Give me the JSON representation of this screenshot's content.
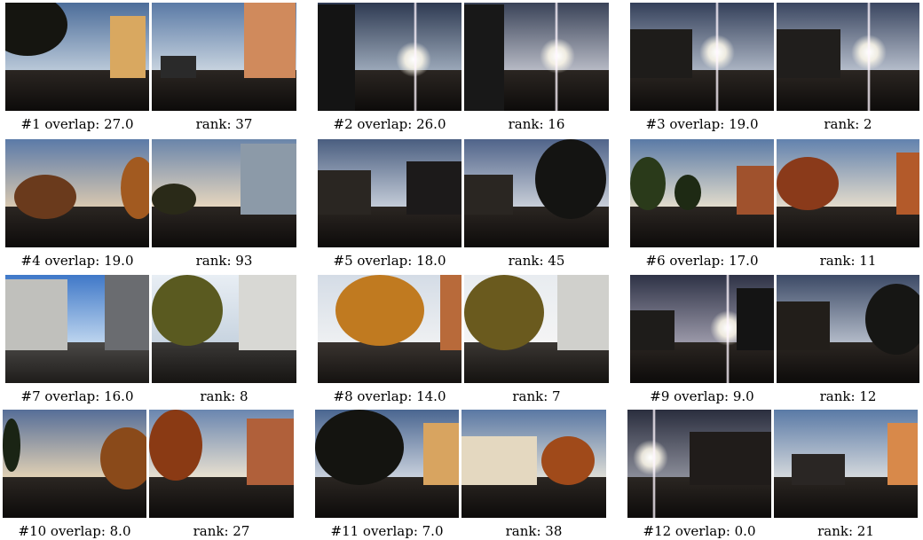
{
  "groups": [
    {
      "caption": "#1 overlap: 27.0",
      "rank": "rank: 37"
    },
    {
      "caption": "#2 overlap: 26.0",
      "rank": "rank: 16"
    },
    {
      "caption": "#3 overlap: 19.0",
      "rank": "rank: 2"
    },
    {
      "caption": "#4 overlap: 19.0",
      "rank": "rank: 93"
    },
    {
      "caption": "#5 overlap: 18.0",
      "rank": "rank: 45"
    },
    {
      "caption": "#6 overlap: 17.0",
      "rank": "rank: 11"
    },
    {
      "caption": "#7 overlap: 16.0",
      "rank": "rank: 8"
    },
    {
      "caption": "#8 overlap: 14.0",
      "rank": "rank: 7"
    },
    {
      "caption": "#9 overlap: 9.0",
      "rank": "rank: 12"
    },
    {
      "caption": "#10 overlap: 8.0",
      "rank": "rank: 27"
    },
    {
      "caption": "#11 overlap: 7.0",
      "rank": "rank: 38"
    },
    {
      "caption": "#12 overlap: 0.0",
      "rank": "rank: 21"
    }
  ]
}
